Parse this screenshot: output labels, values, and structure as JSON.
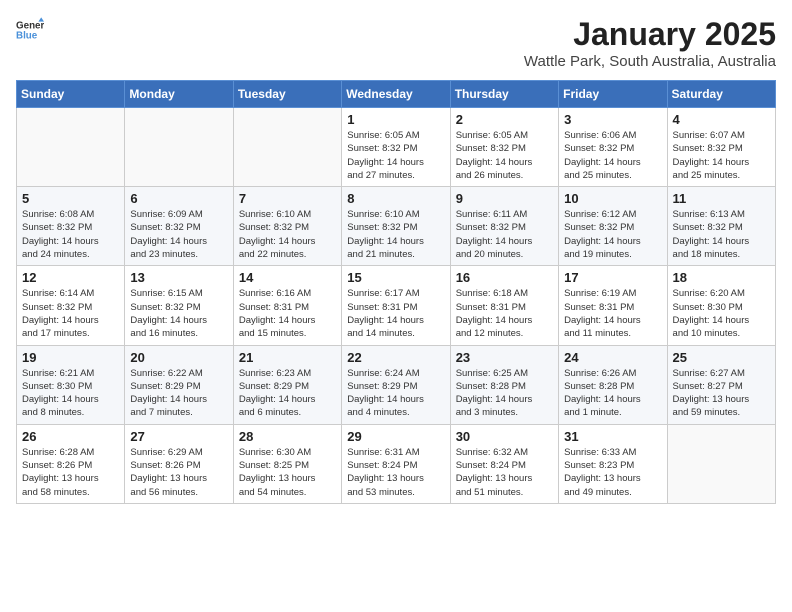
{
  "logo": {
    "general": "General",
    "blue": "Blue"
  },
  "title": "January 2025",
  "location": "Wattle Park, South Australia, Australia",
  "weekdays": [
    "Sunday",
    "Monday",
    "Tuesday",
    "Wednesday",
    "Thursday",
    "Friday",
    "Saturday"
  ],
  "weeks": [
    [
      {
        "day": "",
        "info": ""
      },
      {
        "day": "",
        "info": ""
      },
      {
        "day": "",
        "info": ""
      },
      {
        "day": "1",
        "info": "Sunrise: 6:05 AM\nSunset: 8:32 PM\nDaylight: 14 hours\nand 27 minutes."
      },
      {
        "day": "2",
        "info": "Sunrise: 6:05 AM\nSunset: 8:32 PM\nDaylight: 14 hours\nand 26 minutes."
      },
      {
        "day": "3",
        "info": "Sunrise: 6:06 AM\nSunset: 8:32 PM\nDaylight: 14 hours\nand 25 minutes."
      },
      {
        "day": "4",
        "info": "Sunrise: 6:07 AM\nSunset: 8:32 PM\nDaylight: 14 hours\nand 25 minutes."
      }
    ],
    [
      {
        "day": "5",
        "info": "Sunrise: 6:08 AM\nSunset: 8:32 PM\nDaylight: 14 hours\nand 24 minutes."
      },
      {
        "day": "6",
        "info": "Sunrise: 6:09 AM\nSunset: 8:32 PM\nDaylight: 14 hours\nand 23 minutes."
      },
      {
        "day": "7",
        "info": "Sunrise: 6:10 AM\nSunset: 8:32 PM\nDaylight: 14 hours\nand 22 minutes."
      },
      {
        "day": "8",
        "info": "Sunrise: 6:10 AM\nSunset: 8:32 PM\nDaylight: 14 hours\nand 21 minutes."
      },
      {
        "day": "9",
        "info": "Sunrise: 6:11 AM\nSunset: 8:32 PM\nDaylight: 14 hours\nand 20 minutes."
      },
      {
        "day": "10",
        "info": "Sunrise: 6:12 AM\nSunset: 8:32 PM\nDaylight: 14 hours\nand 19 minutes."
      },
      {
        "day": "11",
        "info": "Sunrise: 6:13 AM\nSunset: 8:32 PM\nDaylight: 14 hours\nand 18 minutes."
      }
    ],
    [
      {
        "day": "12",
        "info": "Sunrise: 6:14 AM\nSunset: 8:32 PM\nDaylight: 14 hours\nand 17 minutes."
      },
      {
        "day": "13",
        "info": "Sunrise: 6:15 AM\nSunset: 8:32 PM\nDaylight: 14 hours\nand 16 minutes."
      },
      {
        "day": "14",
        "info": "Sunrise: 6:16 AM\nSunset: 8:31 PM\nDaylight: 14 hours\nand 15 minutes."
      },
      {
        "day": "15",
        "info": "Sunrise: 6:17 AM\nSunset: 8:31 PM\nDaylight: 14 hours\nand 14 minutes."
      },
      {
        "day": "16",
        "info": "Sunrise: 6:18 AM\nSunset: 8:31 PM\nDaylight: 14 hours\nand 12 minutes."
      },
      {
        "day": "17",
        "info": "Sunrise: 6:19 AM\nSunset: 8:31 PM\nDaylight: 14 hours\nand 11 minutes."
      },
      {
        "day": "18",
        "info": "Sunrise: 6:20 AM\nSunset: 8:30 PM\nDaylight: 14 hours\nand 10 minutes."
      }
    ],
    [
      {
        "day": "19",
        "info": "Sunrise: 6:21 AM\nSunset: 8:30 PM\nDaylight: 14 hours\nand 8 minutes."
      },
      {
        "day": "20",
        "info": "Sunrise: 6:22 AM\nSunset: 8:29 PM\nDaylight: 14 hours\nand 7 minutes."
      },
      {
        "day": "21",
        "info": "Sunrise: 6:23 AM\nSunset: 8:29 PM\nDaylight: 14 hours\nand 6 minutes."
      },
      {
        "day": "22",
        "info": "Sunrise: 6:24 AM\nSunset: 8:29 PM\nDaylight: 14 hours\nand 4 minutes."
      },
      {
        "day": "23",
        "info": "Sunrise: 6:25 AM\nSunset: 8:28 PM\nDaylight: 14 hours\nand 3 minutes."
      },
      {
        "day": "24",
        "info": "Sunrise: 6:26 AM\nSunset: 8:28 PM\nDaylight: 14 hours\nand 1 minute."
      },
      {
        "day": "25",
        "info": "Sunrise: 6:27 AM\nSunset: 8:27 PM\nDaylight: 13 hours\nand 59 minutes."
      }
    ],
    [
      {
        "day": "26",
        "info": "Sunrise: 6:28 AM\nSunset: 8:26 PM\nDaylight: 13 hours\nand 58 minutes."
      },
      {
        "day": "27",
        "info": "Sunrise: 6:29 AM\nSunset: 8:26 PM\nDaylight: 13 hours\nand 56 minutes."
      },
      {
        "day": "28",
        "info": "Sunrise: 6:30 AM\nSunset: 8:25 PM\nDaylight: 13 hours\nand 54 minutes."
      },
      {
        "day": "29",
        "info": "Sunrise: 6:31 AM\nSunset: 8:24 PM\nDaylight: 13 hours\nand 53 minutes."
      },
      {
        "day": "30",
        "info": "Sunrise: 6:32 AM\nSunset: 8:24 PM\nDaylight: 13 hours\nand 51 minutes."
      },
      {
        "day": "31",
        "info": "Sunrise: 6:33 AM\nSunset: 8:23 PM\nDaylight: 13 hours\nand 49 minutes."
      },
      {
        "day": "",
        "info": ""
      }
    ]
  ]
}
